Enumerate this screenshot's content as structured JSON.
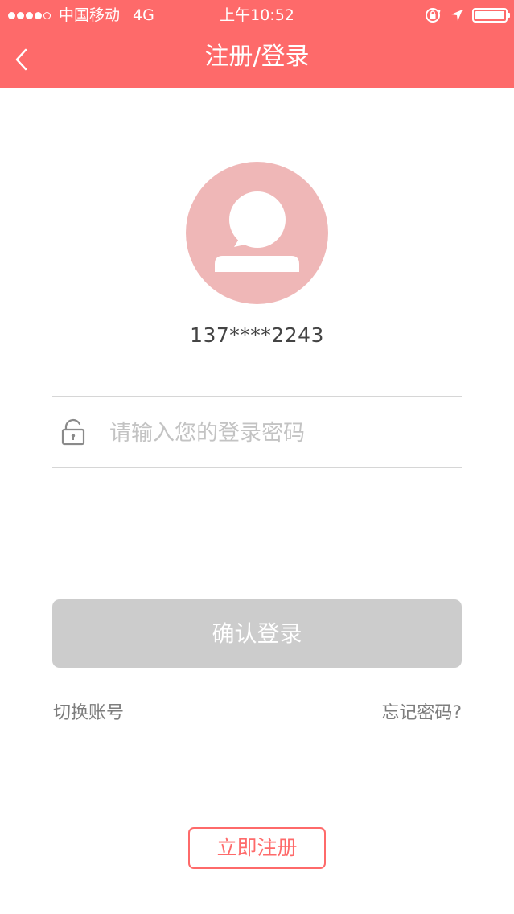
{
  "status_bar": {
    "carrier": "中国移动",
    "network": "4G",
    "time": "上午10:52",
    "icons": [
      "signal-dots-icon",
      "rotation-lock-icon",
      "location-arrow-icon",
      "battery-icon"
    ],
    "battery_level": 1.0
  },
  "nav": {
    "title": "注册/登录",
    "back_icon": "chevron-left-icon"
  },
  "colors": {
    "brand": "#fe6a6a",
    "avatar_bg": "#efb7b7",
    "button_disabled": "#cccccc",
    "placeholder": "#c3c3c3"
  },
  "account": {
    "avatar_icon": "user-avatar-icon",
    "masked_phone": "137****2243"
  },
  "password": {
    "icon": "unlock-icon",
    "placeholder": "请输入您的登录密码",
    "value": ""
  },
  "actions": {
    "confirm_label": "确认登录",
    "switch_account_label": "切换账号",
    "forgot_password_label": "忘记密码?",
    "register_label": "立即注册"
  }
}
